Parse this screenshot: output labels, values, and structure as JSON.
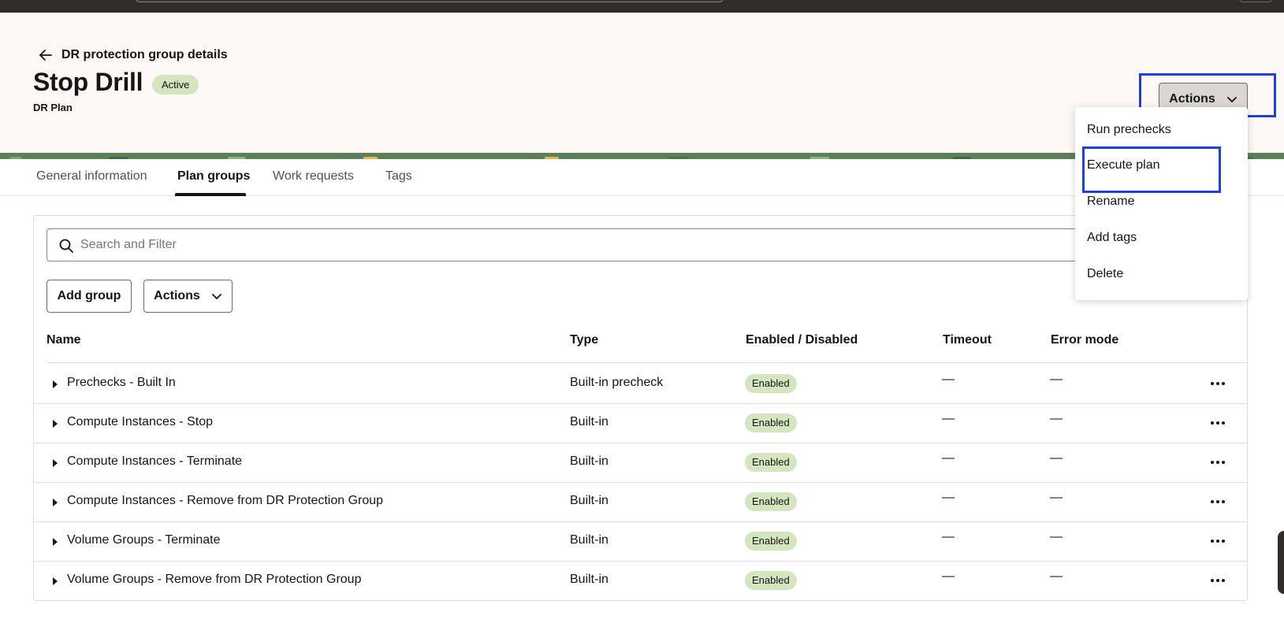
{
  "breadcrumb": {
    "back_label": "DR protection group details"
  },
  "header": {
    "title": "Stop Drill",
    "status": "Active",
    "subtitle": "DR Plan",
    "actions_label": "Actions"
  },
  "tabs": [
    {
      "label": "General information"
    },
    {
      "label": "Plan groups",
      "active": true
    },
    {
      "label": "Work requests"
    },
    {
      "label": "Tags"
    }
  ],
  "search": {
    "placeholder": "Search and Filter",
    "value": ""
  },
  "toolbar": {
    "add_group_label": "Add group",
    "actions_label": "Actions"
  },
  "table": {
    "columns": [
      "Name",
      "Type",
      "Enabled / Disabled",
      "Timeout",
      "Error mode"
    ],
    "rows": [
      {
        "name": "Prechecks - Built In",
        "type": "Built-in precheck",
        "status": "Enabled",
        "timeout": "—",
        "error_mode": "—"
      },
      {
        "name": "Compute Instances - Stop",
        "type": "Built-in",
        "status": "Enabled",
        "timeout": "—",
        "error_mode": "—"
      },
      {
        "name": "Compute Instances - Terminate",
        "type": "Built-in",
        "status": "Enabled",
        "timeout": "—",
        "error_mode": "—"
      },
      {
        "name": "Compute Instances - Remove from DR Protection Group",
        "type": "Built-in",
        "status": "Enabled",
        "timeout": "—",
        "error_mode": "—"
      },
      {
        "name": "Volume Groups - Terminate",
        "type": "Built-in",
        "status": "Enabled",
        "timeout": "—",
        "error_mode": "—"
      },
      {
        "name": "Volume Groups - Remove from DR Protection Group",
        "type": "Built-in",
        "status": "Enabled",
        "timeout": "—",
        "error_mode": "—"
      }
    ]
  },
  "actions_menu": {
    "items": [
      {
        "label": "Run prechecks"
      },
      {
        "label": "Execute plan",
        "highlighted": true
      },
      {
        "label": "Rename"
      },
      {
        "label": "Add tags"
      },
      {
        "label": "Delete"
      }
    ]
  },
  "colors": {
    "highlight": "#1f3fe0",
    "badge_green": "#d4e6bf",
    "topbar": "#312d2a",
    "header_bg": "#fcf8f6"
  },
  "icons": {
    "back": "arrow-left-icon",
    "search": "search-icon",
    "dropdown": "chevron-down-icon",
    "row_expand": "caret-right-icon",
    "row_menu": "kebab-menu-icon"
  }
}
